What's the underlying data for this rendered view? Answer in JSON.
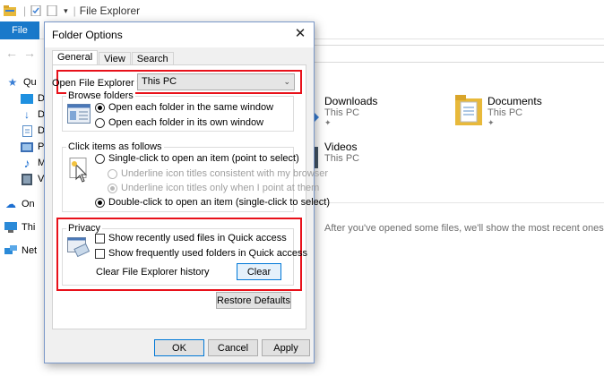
{
  "explorer": {
    "title": "File Explorer",
    "file_tab": "File",
    "sidebar": [
      {
        "icon": "star-icon",
        "label": "Qu",
        "color": "#3a7fd5"
      },
      {
        "icon": "desktop-icon",
        "label": "D",
        "color": "#1e90e0"
      },
      {
        "icon": "download-arrow-icon",
        "label": "D",
        "color": "#1c6fd1"
      },
      {
        "icon": "document-icon",
        "label": "D",
        "color": "#5b8fc9"
      },
      {
        "icon": "pictures-icon",
        "label": "Pi",
        "color": "#3b6fb5"
      },
      {
        "icon": "music-note-icon",
        "label": "M",
        "color": "#1c6fd1"
      },
      {
        "icon": "video-icon",
        "label": "Vi",
        "color": "#445566"
      },
      {
        "icon": "cloud-icon",
        "label": "On",
        "color": "#1c6fd1"
      },
      {
        "icon": "computer-icon",
        "label": "Thi",
        "color": "#2b8ad8"
      },
      {
        "icon": "network-icon",
        "label": "Net",
        "color": "#2b8ad8"
      }
    ],
    "folders": [
      {
        "name": "Downloads",
        "location": "This PC"
      },
      {
        "name": "Documents",
        "location": "This PC"
      },
      {
        "name": "Videos",
        "location": "This PC"
      }
    ],
    "recent_message": "After you've opened some files, we'll show the most recent ones here."
  },
  "dialog": {
    "title": "Folder Options",
    "tabs": [
      "General",
      "View",
      "Search"
    ],
    "active_tab": "General",
    "open_label": "Open File Explorer to:",
    "open_value": "This PC",
    "browse": {
      "legend": "Browse folders",
      "opt_same": "Open each folder in the same window",
      "opt_own": "Open each folder in its own window"
    },
    "click": {
      "legend": "Click items as follows",
      "opt_single": "Single-click to open an item (point to select)",
      "opt_underline_browser": "Underline icon titles consistent with my browser",
      "opt_underline_point": "Underline icon titles only when I point at them",
      "opt_double": "Double-click to open an item (single-click to select)"
    },
    "privacy": {
      "legend": "Privacy",
      "recent_files": "Show recently used files in Quick access",
      "frequent_folders": "Show frequently used folders in Quick access",
      "clear_label": "Clear File Explorer history",
      "clear_button": "Clear"
    },
    "restore_button": "Restore Defaults",
    "ok_button": "OK",
    "cancel_button": "Cancel",
    "apply_button": "Apply"
  },
  "colors": {
    "highlight": "#e8111a",
    "accent": "#0078d7",
    "file_tab": "#1979ca"
  }
}
